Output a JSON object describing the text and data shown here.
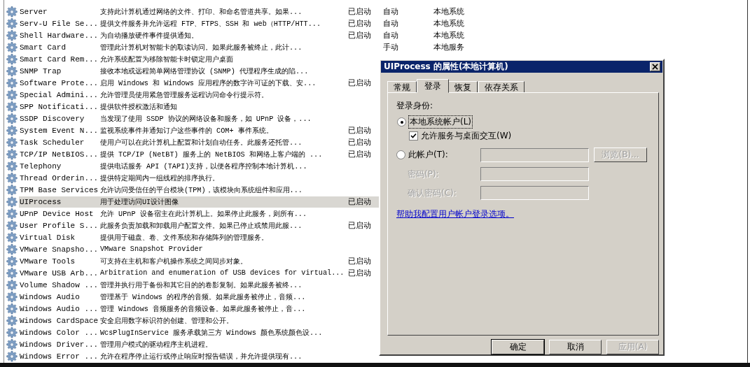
{
  "services": {
    "rows": [
      {
        "name": "Server",
        "description": "支持此计算机通过网络的文件、打印、和命名管道共享。如果...",
        "status": "已启动",
        "startup": "自动",
        "logon": "本地系统",
        "selected": false
      },
      {
        "name": "Serv-U File Se...",
        "description": "提供文件服务并允许远程 FTP、FTPS、SSH 和 web（HTTP/HTT...",
        "status": "已启动",
        "startup": "自动",
        "logon": "本地系统",
        "selected": false
      },
      {
        "name": "Shell Hardware...",
        "description": "为自动播放硬件事件提供通知。",
        "status": "已启动",
        "startup": "自动",
        "logon": "本地系统",
        "selected": false
      },
      {
        "name": "Smart Card",
        "description": "管理此计算机对智能卡的取读访问。如果此服务被终止，此计...",
        "startup": "手动",
        "logon": "本地服务",
        "selected": false
      },
      {
        "name": "Smart Card Rem...",
        "description": "允许系统配置为移除智能卡时锁定用户桌面",
        "selected": false
      },
      {
        "name": "SNMP Trap",
        "description": "接收本地或远程简单网络管理协议 (SNMP) 代理程序生成的陷...",
        "selected": false
      },
      {
        "name": "Software Prote...",
        "description": "启用 Windows 和 Windows 应用程序的数字许可证的下载、安...",
        "status": "已启动",
        "selected": false
      },
      {
        "name": "Special Admini...",
        "description": "允许管理员使用紧急管理服务远程访问命令行提示符。",
        "selected": false
      },
      {
        "name": "SPP Notificati...",
        "description": "提供软件授权激活和通知",
        "selected": false
      },
      {
        "name": "SSDP Discovery",
        "description": "当发现了使用 SSDP 协议的网络设备和服务，如 UPnP 设备，...",
        "selected": false
      },
      {
        "name": "System Event N...",
        "description": "监视系统事件并通知订户这些事件的 COM+ 事件系统。",
        "status": "已启动",
        "selected": false
      },
      {
        "name": "Task Scheduler",
        "description": "使用户可以在此计算机上配置和计划自动任务。此服务还托管...",
        "status": "已启动",
        "selected": false
      },
      {
        "name": "TCP/IP NetBIOS...",
        "description": "提供 TCP/IP (NetBT) 服务上的 NetBIOS 和网络上客户端的 ...",
        "status": "已启动",
        "selected": false
      },
      {
        "name": "Telephony",
        "description": "提供电话服务 API (TAPI)支持，以便各程序控制本地计算机...",
        "selected": false
      },
      {
        "name": "Thread Orderin...",
        "description": "提供特定期间内一组线程的排序执行。",
        "selected": false
      },
      {
        "name": "TPM Base Services",
        "description": "允许访问受信任的平台模块(TPM)，该模块向系统组件和应用...",
        "selected": false
      },
      {
        "name": "UIProcess",
        "description": "用于处理访问UI设计图像",
        "status": "已启动",
        "selected": true
      },
      {
        "name": "UPnP Device Host",
        "description": "允许 UPnP 设备宿主在此计算机上。如果停止此服务，则所有...",
        "selected": false
      },
      {
        "name": "User Profile S...",
        "description": "此服务负责加载和卸载用户配置文件。如果已停止或禁用此服...",
        "status": "已启动",
        "selected": false
      },
      {
        "name": "Virtual Disk",
        "description": "提供用于磁盘、卷、文件系统和存储阵列的管理服务。",
        "selected": false
      },
      {
        "name": "VMware Snapsho...",
        "description": "VMware Snapshot Provider",
        "selected": false
      },
      {
        "name": "VMware Tools",
        "description": "可支持在主机和客户机操作系统之间同步对象。",
        "status": "已启动",
        "selected": false
      },
      {
        "name": "VMware USB Arb...",
        "description": "Arbitration and enumeration of USB devices for virtual...",
        "status": "已启动",
        "selected": false
      },
      {
        "name": "Volume Shadow ...",
        "description": "管理并执行用于备份和其它目的的卷影复制。如果此服务被终...",
        "selected": false
      },
      {
        "name": "Windows Audio",
        "description": "管理基于 Windows 的程序的音频。如果此服务被停止，音频...",
        "selected": false
      },
      {
        "name": "Windows Audio ...",
        "description": "管理 Windows 音频服务的音频设备。如果此服务被停止，音...",
        "selected": false
      },
      {
        "name": "Windows CardSpace",
        "description": "安全启用数字标识符的创建、管理和公开。",
        "selected": false
      },
      {
        "name": "Windows Color ...",
        "description": "WcsPlugInService 服务承载第三方 Windows 颜色系统颜色设...",
        "selected": false
      },
      {
        "name": "Windows Driver...",
        "description": "管理用户模式的驱动程序主机进程。",
        "selected": false
      },
      {
        "name": "Windows Error ...",
        "description": "允许在程序停止运行或停止响应时报告错误，并允许提供现有...",
        "selected": false
      }
    ]
  },
  "dialog": {
    "title": "UIProcess 的属性(本地计算机)",
    "tabs": [
      {
        "label": "常规",
        "selected": false
      },
      {
        "label": "登录",
        "selected": true
      },
      {
        "label": "恢复",
        "selected": false
      },
      {
        "label": "依存关系",
        "selected": false
      }
    ],
    "logon_as_label": "登录身份:",
    "local_system": {
      "label": "本地系统帐户(L)",
      "selected": true
    },
    "desktop_interact": {
      "label": "允许服务与桌面交互(W)",
      "checked": true
    },
    "this_account": {
      "label": "此帐户(T):",
      "selected": false
    },
    "browse_button": "浏览(B)...",
    "password_fields": [
      {
        "label": "密码(P):"
      },
      {
        "label": "确认密码(C):"
      }
    ],
    "help_link": "帮助我配置用户帐户登录选项。",
    "buttons": [
      {
        "label": "确定",
        "default": true,
        "disabled": false
      },
      {
        "label": "取消",
        "default": false,
        "disabled": false
      },
      {
        "label": "应用(A)",
        "default": false,
        "disabled": true
      }
    ]
  }
}
